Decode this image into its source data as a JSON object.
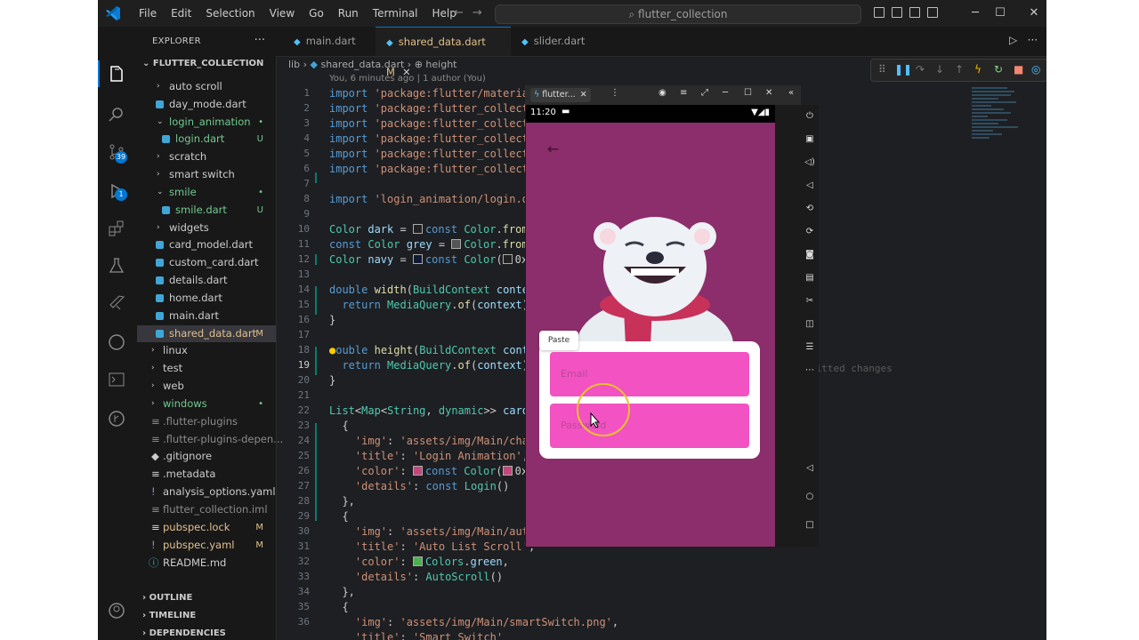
{
  "titlebar": {
    "menu": [
      "File",
      "Edit",
      "Selection",
      "View",
      "Go",
      "Run",
      "Terminal",
      "Help"
    ],
    "search_text": "flutter_collection"
  },
  "activity": {
    "source_control_badge": "39",
    "run_badge": "1"
  },
  "sidebar": {
    "title": "EXPLORER",
    "root": "FLUTTER_COLLECTION",
    "items": [
      {
        "label": "auto scroll",
        "status": ""
      },
      {
        "label": "day_mode.dart",
        "status": ""
      },
      {
        "label": "login_animation",
        "status": "•"
      },
      {
        "label": "login.dart",
        "status": "U"
      },
      {
        "label": "scratch",
        "status": ""
      },
      {
        "label": "smart switch",
        "status": ""
      },
      {
        "label": "smile",
        "status": "•"
      },
      {
        "label": "smile.dart",
        "status": "U"
      },
      {
        "label": "widgets",
        "status": ""
      },
      {
        "label": "card_model.dart",
        "status": ""
      },
      {
        "label": "custom_card.dart",
        "status": ""
      },
      {
        "label": "details.dart",
        "status": ""
      },
      {
        "label": "home.dart",
        "status": ""
      },
      {
        "label": "main.dart",
        "status": ""
      },
      {
        "label": "shared_data.dart",
        "status": "M"
      },
      {
        "label": "linux",
        "status": ""
      },
      {
        "label": "test",
        "status": ""
      },
      {
        "label": "web",
        "status": ""
      },
      {
        "label": "windows",
        "status": "•"
      },
      {
        "label": ".flutter-plugins",
        "status": ""
      },
      {
        "label": ".flutter-plugins-depen...",
        "status": ""
      },
      {
        "label": ".gitignore",
        "status": ""
      },
      {
        "label": ".metadata",
        "status": ""
      },
      {
        "label": "analysis_options.yaml",
        "status": ""
      },
      {
        "label": "flutter_collection.iml",
        "status": ""
      },
      {
        "label": "pubspec.lock",
        "status": "M"
      },
      {
        "label": "pubspec.yaml",
        "status": "M"
      },
      {
        "label": "README.md",
        "status": ""
      }
    ],
    "sections": [
      "OUTLINE",
      "TIMELINE",
      "DEPENDENCIES"
    ]
  },
  "tabs": [
    {
      "label": "main.dart"
    },
    {
      "label": "shared_data.dart M"
    },
    {
      "label": "slider.dart"
    }
  ],
  "breadcrumb": {
    "a": "lib",
    "b": "shared_data.dart",
    "c": "height"
  },
  "blame": "You, 6 minutes ago | 1 author (You)",
  "code": {
    "line_numbers": [
      "1",
      "2",
      "3",
      "4",
      "5",
      "6",
      "7",
      "8",
      "9",
      "10",
      "11",
      "12",
      "13",
      "14",
      "15",
      "16",
      "17",
      "18",
      "19",
      "20",
      "21",
      "22",
      "23",
      "24",
      "25",
      "26",
      "27",
      "28",
      "29",
      "30",
      "31",
      "32",
      "33",
      "34",
      "35",
      "36"
    ],
    "l1": "'package:flutter/material",
    "l2": "'package:flutter_collecti",
    "l3": "'package:flutter_collecti",
    "l4": "'package:flutter_collecti",
    "l5": "'package:flutter_collecti",
    "l6": "'package:flutter_collecti",
    "l8": "'login_animation/login.da",
    "l24": "'assets/img/Main/char",
    "l25": "'Login Animation'",
    "l30": "'assets/img/Main/auto",
    "l31": "'Auto List Scroll'",
    "l36": "'assets/img/Main/smartSwitch.png'",
    "l37": "'Smart Switch'",
    "ghost": "mitted changes"
  },
  "emulator": {
    "tab": "flutter...",
    "time": "11:20",
    "paste": "Paste",
    "email_placeholder": "Email",
    "password_placeholder": "Password"
  },
  "colors": {
    "phone_bg": "#8b2e6b",
    "field": "#f252c2",
    "accent": "#0078d4"
  }
}
